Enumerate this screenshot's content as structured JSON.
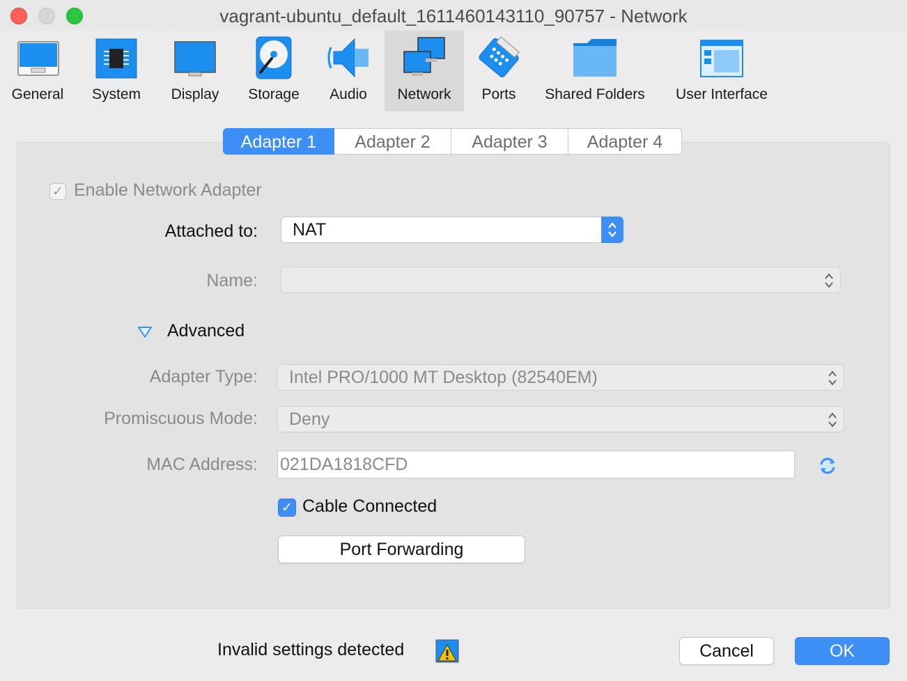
{
  "window": {
    "title": "vagrant-ubuntu_default_1611460143110_90757 - Network"
  },
  "toolbar": {
    "items": [
      {
        "label": "General",
        "icon": "general-icon",
        "selected": false
      },
      {
        "label": "System",
        "icon": "chip-icon",
        "selected": false
      },
      {
        "label": "Display",
        "icon": "monitor-icon",
        "selected": false
      },
      {
        "label": "Storage",
        "icon": "disk-icon",
        "selected": false
      },
      {
        "label": "Audio",
        "icon": "speaker-icon",
        "selected": false
      },
      {
        "label": "Network",
        "icon": "network-icon",
        "selected": true
      },
      {
        "label": "Ports",
        "icon": "serial-port-icon",
        "selected": false
      },
      {
        "label": "Shared Folders",
        "icon": "folder-icon",
        "selected": false
      },
      {
        "label": "User Interface",
        "icon": "window-layout-icon",
        "selected": false
      }
    ]
  },
  "tabs": [
    {
      "label": "Adapter 1",
      "active": true
    },
    {
      "label": "Adapter 2",
      "active": false
    },
    {
      "label": "Adapter 3",
      "active": false
    },
    {
      "label": "Adapter 4",
      "active": false
    }
  ],
  "form": {
    "enable_adapter_label": "Enable Network Adapter",
    "attached_to_label": "Attached to:",
    "attached_to_value": "NAT",
    "name_label": "Name:",
    "name_value": "",
    "advanced_label": "Advanced",
    "adapter_type_label": "Adapter Type:",
    "adapter_type_value": "Intel PRO/1000 MT Desktop (82540EM)",
    "promiscuous_label": "Promiscuous Mode:",
    "promiscuous_value": "Deny",
    "mac_label": "MAC Address:",
    "mac_value": "021DA1818CFD",
    "cable_connected_label": "Cable Connected",
    "port_forwarding_label": "Port Forwarding"
  },
  "footer": {
    "status": "Invalid settings detected",
    "cancel_label": "Cancel",
    "ok_label": "OK"
  },
  "colors": {
    "accent": "#3d8ef5",
    "close": "#fe5f57",
    "maximize": "#28c840"
  }
}
